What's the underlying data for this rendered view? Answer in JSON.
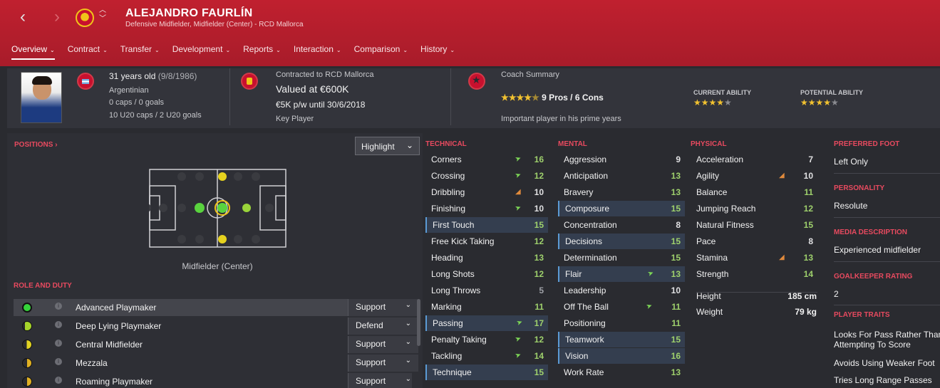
{
  "header": {
    "player_name": "ALEJANDRO FAURLÍN",
    "subtitle": "Defensive Midfielder, Midfielder (Center) - RCD Mallorca",
    "tabs": [
      {
        "label": "Overview",
        "active": true
      },
      {
        "label": "Contract"
      },
      {
        "label": "Transfer"
      },
      {
        "label": "Development"
      },
      {
        "label": "Reports"
      },
      {
        "label": "Interaction"
      },
      {
        "label": "Comparison"
      },
      {
        "label": "History"
      }
    ]
  },
  "summary": {
    "age": "31 years old",
    "dob": "(9/8/1986)",
    "nationality": "Argentinian",
    "caps": "0 caps / 0 goals",
    "u20_caps": "10 U20 caps / 2 U20 goals",
    "contract_label": "Contracted to RCD Mallorca",
    "value": "Valued at €600K",
    "wage": "€5K p/w until 30/6/2018",
    "squad_status": "Key Player",
    "coach_title": "Coach Summary",
    "pros_cons": "9 Pros / 6 Cons",
    "coach_stars": 4,
    "coach_note": "Important player in his prime years",
    "current_ability_label": "CURRENT ABILITY",
    "current_ability_stars": 4,
    "potential_ability_label": "POTENTIAL ABILITY",
    "potential_ability_stars": 4
  },
  "positions": {
    "title": "POSITIONS ›",
    "highlight_label": "Highlight",
    "position_name": "Midfielder (Center)"
  },
  "roles": {
    "title": "ROLE AND DUTY",
    "items": [
      {
        "name": "Advanced Playmaker",
        "duty": "Support",
        "rating": "full",
        "selected": true
      },
      {
        "name": "Deep Lying Playmaker",
        "duty": "Defend",
        "rating": "high"
      },
      {
        "name": "Central Midfielder",
        "duty": "Support",
        "rating": "mid"
      },
      {
        "name": "Mezzala",
        "duty": "Support",
        "rating": "low"
      },
      {
        "name": "Roaming Playmaker",
        "duty": "Support",
        "rating": "low"
      }
    ]
  },
  "technical": {
    "title": "TECHNICAL",
    "items": [
      {
        "name": "Corners",
        "value": "16",
        "trend": "up"
      },
      {
        "name": "Crossing",
        "value": "12",
        "trend": "up"
      },
      {
        "name": "Dribbling",
        "value": "10",
        "trend": "down"
      },
      {
        "name": "Finishing",
        "value": "10",
        "trend": "up"
      },
      {
        "name": "First Touch",
        "value": "15",
        "hl": true
      },
      {
        "name": "Free Kick Taking",
        "value": "12"
      },
      {
        "name": "Heading",
        "value": "13"
      },
      {
        "name": "Long Shots",
        "value": "12"
      },
      {
        "name": "Long Throws",
        "value": "5"
      },
      {
        "name": "Marking",
        "value": "11"
      },
      {
        "name": "Passing",
        "value": "17",
        "trend": "up",
        "hl": true
      },
      {
        "name": "Penalty Taking",
        "value": "12",
        "trend": "up"
      },
      {
        "name": "Tackling",
        "value": "14",
        "trend": "up"
      },
      {
        "name": "Technique",
        "value": "15",
        "hl": true
      }
    ]
  },
  "mental": {
    "title": "MENTAL",
    "items": [
      {
        "name": "Aggression",
        "value": "9"
      },
      {
        "name": "Anticipation",
        "value": "13"
      },
      {
        "name": "Bravery",
        "value": "13"
      },
      {
        "name": "Composure",
        "value": "15",
        "hl": true
      },
      {
        "name": "Concentration",
        "value": "8"
      },
      {
        "name": "Decisions",
        "value": "15",
        "hl": true
      },
      {
        "name": "Determination",
        "value": "15"
      },
      {
        "name": "Flair",
        "value": "13",
        "trend": "up",
        "hl": true
      },
      {
        "name": "Leadership",
        "value": "10"
      },
      {
        "name": "Off The Ball",
        "value": "11",
        "trend": "up"
      },
      {
        "name": "Positioning",
        "value": "11"
      },
      {
        "name": "Teamwork",
        "value": "15",
        "hl": true
      },
      {
        "name": "Vision",
        "value": "16",
        "hl": true
      },
      {
        "name": "Work Rate",
        "value": "13"
      }
    ]
  },
  "physical": {
    "title": "PHYSICAL",
    "items": [
      {
        "name": "Acceleration",
        "value": "7"
      },
      {
        "name": "Agility",
        "value": "10",
        "trend": "down"
      },
      {
        "name": "Balance",
        "value": "11"
      },
      {
        "name": "Jumping Reach",
        "value": "12"
      },
      {
        "name": "Natural Fitness",
        "value": "15"
      },
      {
        "name": "Pace",
        "value": "8"
      },
      {
        "name": "Stamina",
        "value": "13",
        "trend": "down"
      },
      {
        "name": "Strength",
        "value": "14"
      }
    ],
    "height_label": "Height",
    "height": "185 cm",
    "weight_label": "Weight",
    "weight": "79 kg"
  },
  "info": {
    "preferred_foot_label": "PREFERRED FOOT",
    "preferred_foot": "Left Only",
    "personality_label": "PERSONALITY",
    "personality": "Resolute",
    "media_label": "MEDIA DESCRIPTION",
    "media": "Experienced midfielder",
    "gk_label": "GOALKEEPER RATING",
    "gk": "2",
    "traits_label": "PLAYER TRAITS",
    "traits": [
      "Looks For Pass Rather Than",
      "Attempting To Score",
      "Avoids Using Weaker Foot",
      "Tries Long Range Passes"
    ]
  },
  "colors": {
    "header_red": "#c0202f",
    "accent_red": "#e84a5f",
    "good_green": "#9ed06c",
    "highlight_blue": "#5b9bd5"
  }
}
